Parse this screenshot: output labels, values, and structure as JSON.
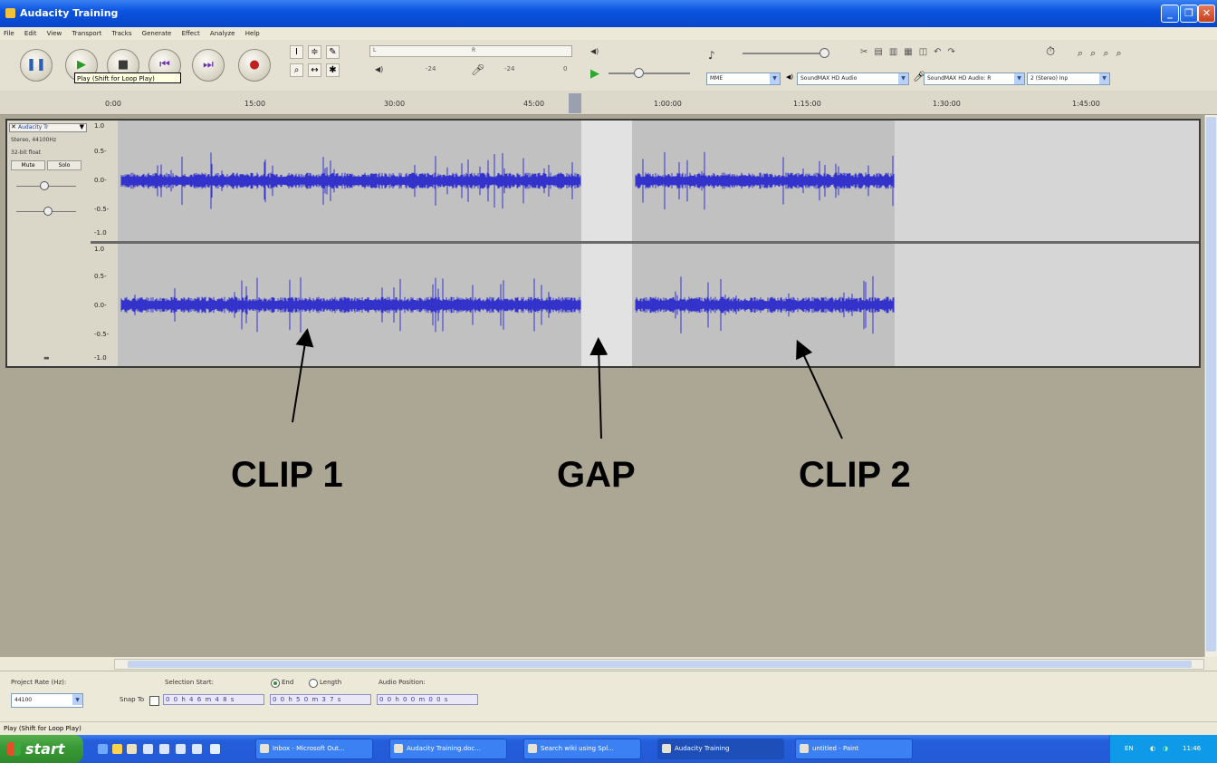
{
  "window": {
    "title": "Audacity Training"
  },
  "menu": [
    "File",
    "Edit",
    "View",
    "Transport",
    "Tracks",
    "Generate",
    "Effect",
    "Analyze",
    "Help"
  ],
  "transport": {
    "buttons": [
      {
        "name": "pause",
        "glyph": "❚❚",
        "color": "#2b5fb3"
      },
      {
        "name": "play",
        "glyph": "▶",
        "color": "#2a9a2a"
      },
      {
        "name": "stop",
        "glyph": "■",
        "color": "#3a3a3a"
      },
      {
        "name": "skip-start",
        "glyph": "⏮",
        "color": "#6b2fb0"
      },
      {
        "name": "skip-end",
        "glyph": "⏭",
        "color": "#6b2fb0"
      },
      {
        "name": "record",
        "glyph": "●",
        "color": "#c02020"
      }
    ],
    "tooltip": "Play (Shift for Loop Play)"
  },
  "meters": {
    "left_label": "L",
    "right_label": "R",
    "db1": "-24",
    "db2": "0"
  },
  "devices": {
    "host": "MME",
    "output": "SoundMAX HD Audio",
    "input": "SoundMAX HD Audio: R",
    "channels": "2 (Stereo) Inp"
  },
  "ruler": {
    "ticks": [
      "0:00",
      "15:00",
      "30:00",
      "45:00",
      "1:00:00",
      "1:15:00",
      "1:30:00",
      "1:45:00"
    ]
  },
  "track": {
    "name": "Audacity Tr",
    "info1": "Stereo, 44100Hz",
    "info2": "32-bit float",
    "mute": "Mute",
    "solo": "Solo",
    "scale": [
      "1.0",
      "0.5-",
      "0.0-",
      "-0.5-",
      "-1.0"
    ]
  },
  "annotations": {
    "clip1": "CLIP 1",
    "gap": "GAP",
    "clip2": "CLIP 2"
  },
  "selection_bar": {
    "project_rate_label": "Project Rate (Hz):",
    "project_rate": "44100",
    "snap_label": "Snap To",
    "selection_start_label": "Selection Start:",
    "end_label": "End",
    "length_label": "Length",
    "audio_position_label": "Audio Position:",
    "selection_start": "0 0 h 4 6 m 4 8 s",
    "selection_end": "0 0 h 5 0 m 3 7 s",
    "audio_position": "0 0 h 0 0 m 0 0 s"
  },
  "status": "Play (Shift for Loop Play)",
  "taskbar": {
    "start": "start",
    "tasks": [
      {
        "label": "Inbox - Microsoft Out...",
        "active": false
      },
      {
        "label": "Audacity Training.doc...",
        "active": false
      },
      {
        "label": "Search wiki using Spl...",
        "active": false
      },
      {
        "label": "Audacity Training",
        "active": true
      },
      {
        "label": "untitled - Paint",
        "active": false
      }
    ],
    "lang": "EN",
    "clock": "11:46"
  }
}
